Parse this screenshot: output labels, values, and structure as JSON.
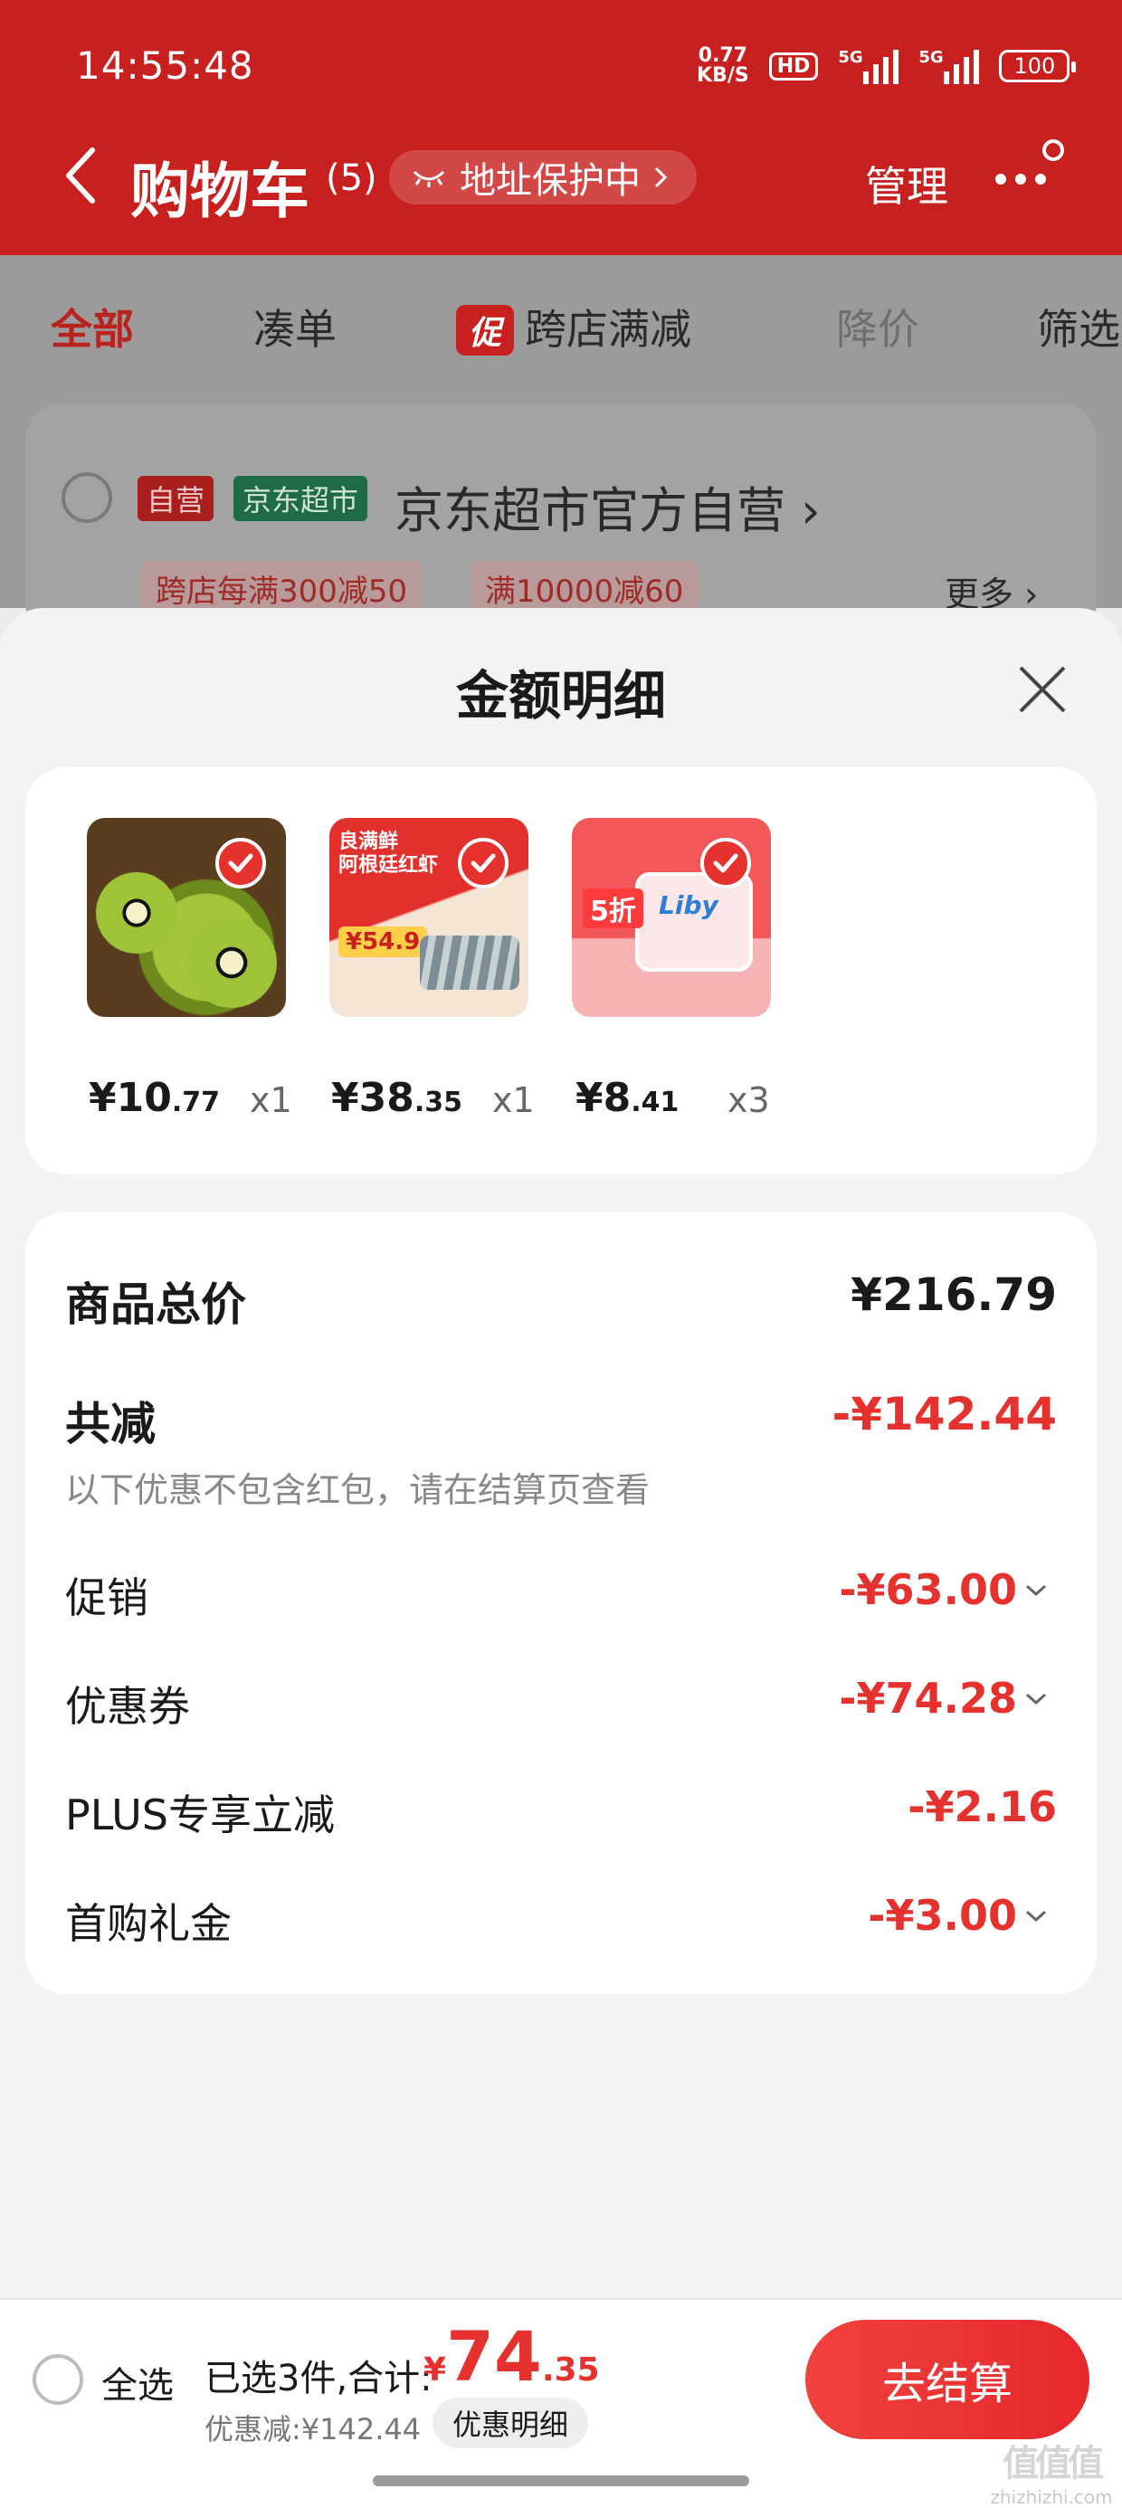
{
  "status_bar": {
    "time": "14:55:48",
    "net_speed_value": "0.77",
    "net_speed_unit": "KB/S",
    "hd_label": "HD",
    "sig1_label": "5G",
    "sig2_label": "5G",
    "battery": "100"
  },
  "header": {
    "title": "购物车",
    "count": "(5)",
    "address_protect": "地址保护中",
    "manage": "管理"
  },
  "tabs": {
    "all": "全部",
    "combine": "凑单",
    "promo_tag": "促",
    "cross_store": "跨店满减",
    "price_drop": "降价",
    "filter": "筛选"
  },
  "store": {
    "badge_self": "自营",
    "badge_jd": "京东超市",
    "name": "京东超市官方自营",
    "coupons": [
      "跨店每满300减50",
      "满10000减60"
    ],
    "more": "更多"
  },
  "sheet": {
    "title": "金额明细",
    "products": [
      {
        "price_int": "¥10",
        "price_dec": ".77",
        "qty": "x1"
      },
      {
        "price_int": "¥38",
        "price_dec": ".35",
        "qty": "x1",
        "img_text_1": "良满鲜",
        "img_text_2": "阿根廷红虾",
        "img_price": "¥54.9"
      },
      {
        "price_int": "¥8",
        "price_dec": ".41",
        "qty": "x3",
        "img_sale": "5折",
        "img_brand": "Liby"
      }
    ],
    "summary": {
      "total_label": "商品总价",
      "total_value": "¥216.79",
      "reduce_label": "共减",
      "reduce_value": "-¥142.44",
      "note": "以下优惠不包含红包，请在结算页查看",
      "items": [
        {
          "label": "促销",
          "value": "-¥63.00"
        },
        {
          "label": "优惠券",
          "value": "-¥74.28"
        },
        {
          "label": "PLUS专享立减",
          "value": "-¥2.16"
        },
        {
          "label": "首购礼金",
          "value": "-¥3.00"
        }
      ]
    }
  },
  "bottom_bar": {
    "select_all": "全选",
    "selected_info": "已选3件,合计:",
    "total_symbol": "¥",
    "total_int": "74",
    "total_dec": ".35",
    "discount_line": "优惠减:¥142.44",
    "detail_button": "优惠明细",
    "checkout": "去结算"
  },
  "watermark": {
    "main": "值值值",
    "sub": "zhizhizhi.com"
  },
  "colors": {
    "header_red": "#c7201f",
    "accent_red": "#e5322e"
  }
}
